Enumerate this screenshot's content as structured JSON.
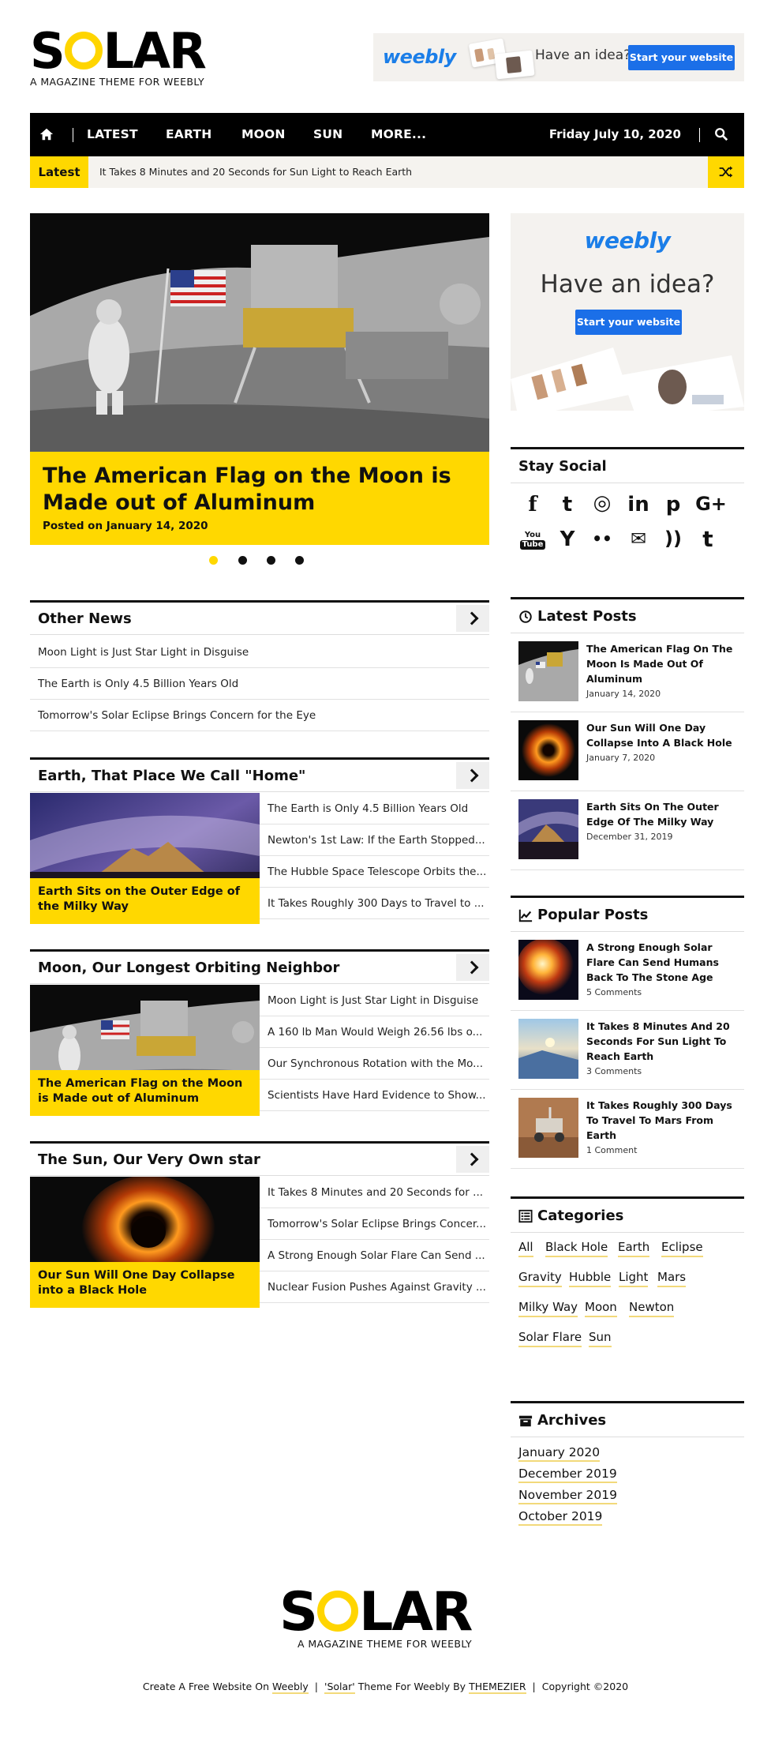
{
  "header": {
    "logo_left": "S",
    "logo_right": "LAR",
    "tagline": "A MAGAZINE THEME FOR WEEBLY"
  },
  "top_ad": {
    "brand": "weebly",
    "text": "Have an idea?",
    "button": "Start your website"
  },
  "nav": {
    "items": [
      "LATEST",
      "EARTH",
      "MOON",
      "SUN",
      "MORE..."
    ],
    "date": "Friday July 10, 2020",
    "home_icon": "home-icon",
    "search_icon": "search-icon"
  },
  "ticker": {
    "label": "Latest",
    "text": "It Takes 8 Minutes and 20 Seconds for Sun Light to Reach Earth",
    "shuffle_icon": "shuffle-icon"
  },
  "hero": {
    "title": "The American Flag on the Moon is Made out of Aluminum",
    "meta": "Posted on January 14, 2020",
    "slides": 4,
    "active_slide": 1
  },
  "other_news": {
    "title": "Other News",
    "items": [
      "Moon Light is Just Star Light in Disguise",
      "The Earth is Only 4.5 Billion Years Old",
      "Tomorrow's Solar Eclipse Brings Concern for the Eye"
    ]
  },
  "sections": [
    {
      "title": "Earth, That Place We Call \"Home\"",
      "feature": "Earth Sits on the Outer Edge of the Milky Way",
      "items": [
        "The Earth is Only 4.5 Billion Years Old",
        "Newton's 1st Law: If the Earth Stopped...",
        "The Hubble Space Telescope Orbits the...",
        "It Takes Roughly 300 Days to Travel to ..."
      ]
    },
    {
      "title": "Moon, Our Longest Orbiting Neighbor",
      "feature": "The American Flag on the Moon is Made out of Aluminum",
      "items": [
        "Moon Light is Just Star Light in Disguise",
        "A 160 lb Man Would Weigh 26.56 lbs o...",
        "Our Synchronous Rotation with the Mo...",
        "Scientists Have Hard Evidence to Show..."
      ]
    },
    {
      "title": "The Sun, Our Very Own star",
      "feature": "Our Sun Will One Day Collapse into a Black Hole",
      "items": [
        "It Takes 8 Minutes and 20 Seconds for ...",
        "Tomorrow's Solar Eclipse Brings Concer...",
        "A Strong Enough Solar Flare Can Send ...",
        "Nuclear Fusion Pushes Against Gravity ..."
      ]
    }
  ],
  "side_ad": {
    "brand": "weebly",
    "text": "Have an idea?",
    "button": "Start your website"
  },
  "stay_social": {
    "title": "Stay Social",
    "icons": [
      "facebook-icon",
      "twitter-icon",
      "instagram-icon",
      "linkedin-icon",
      "pinterest-icon",
      "google-plus-icon",
      "youtube-icon",
      "hacker-news-icon",
      "flickr-icon",
      "email-icon",
      "rss-icon",
      "tumblr-icon"
    ],
    "glyphs": [
      "f",
      "t",
      "◎",
      "in",
      "p",
      "G+",
      "You",
      "Y",
      "••",
      "✉",
      "))",
      "t"
    ]
  },
  "latest_posts": {
    "title": "Latest Posts",
    "items": [
      {
        "title": "The American Flag On The Moon Is Made Out Of Aluminum",
        "meta": "January 14, 2020"
      },
      {
        "title": "Our Sun Will One Day Collapse Into A Black Hole",
        "meta": "January 7, 2020"
      },
      {
        "title": "Earth Sits On The Outer Edge Of The Milky Way",
        "meta": "December 31, 2019"
      }
    ]
  },
  "popular_posts": {
    "title": "Popular Posts",
    "items": [
      {
        "title": "A Strong Enough Solar Flare Can Send Humans Back To The Stone Age",
        "meta": "5 Comments"
      },
      {
        "title": "It Takes 8 Minutes And 20 Seconds For Sun Light To Reach Earth",
        "meta": "3 Comments"
      },
      {
        "title": "It Takes Roughly 300 Days To Travel To Mars From Earth",
        "meta": "1 Comment"
      }
    ]
  },
  "categories": {
    "title": "Categories",
    "items": [
      "All",
      "Black Hole",
      "Earth",
      "Eclipse",
      "Gravity",
      "Hubble",
      "Light",
      "Mars",
      "Milky Way",
      "Moon",
      "Newton",
      "Solar Flare",
      "Sun"
    ]
  },
  "archives": {
    "title": "Archives",
    "items": [
      "January 2020",
      "December 2019",
      "November 2019",
      "October 2019"
    ]
  },
  "footer": {
    "logo_left": "S",
    "logo_right": "LAR",
    "tagline": "A MAGAZINE THEME FOR WEEBLY",
    "part1": "Create A Free Website On ",
    "weebly": "Weebly",
    "part2": "'Solar'",
    "part3": " Theme For Weebly By ",
    "themezier": "THEMEZIER",
    "copyright": "Copyright ©2020",
    "separator": "|"
  },
  "colors": {
    "accent": "#ffd800",
    "nav_bg": "#000000",
    "weebly_blue": "#1b6fe8",
    "ticker_bg": "#f5f3ef"
  }
}
